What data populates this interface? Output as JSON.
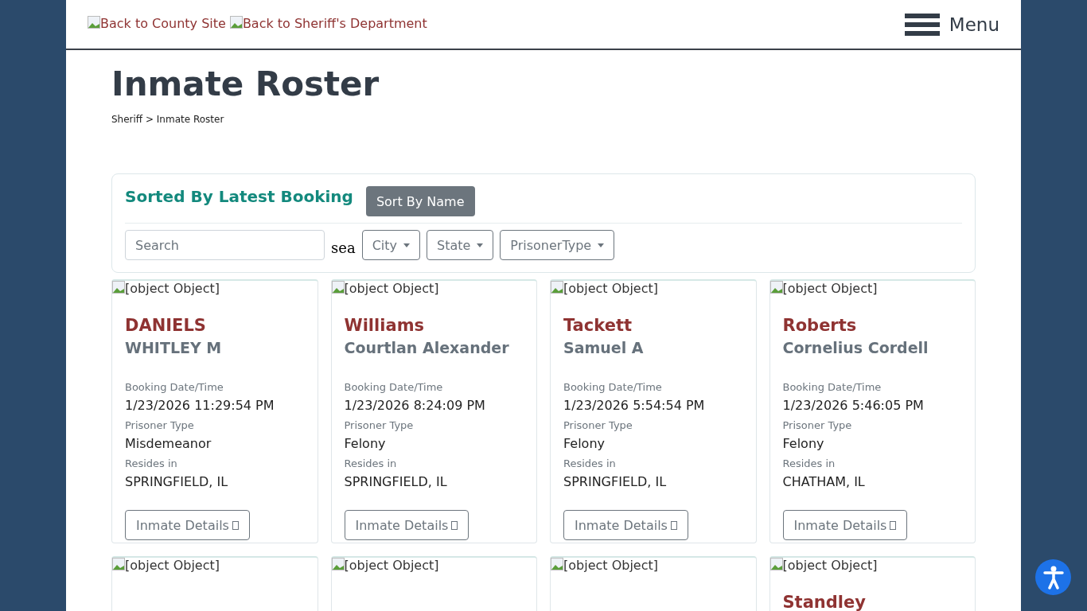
{
  "header": {
    "links": [
      "Back to County Site",
      "Back to Sheriff's Department"
    ],
    "menu_label": "Menu"
  },
  "page": {
    "title": "Inmate Roster",
    "breadcrumb": "Sheriff > Inmate Roster"
  },
  "toolbar": {
    "sort_heading": "Sorted By Latest Booking",
    "sort_button": "Sort By Name",
    "search": {
      "placeholder": "Search"
    },
    "search_label": "sea",
    "filters": [
      "City",
      "State",
      "PrisonerType"
    ]
  },
  "inmates": [
    {
      "image_alt": "[object Object]",
      "last_name": "DANIELS",
      "first_name": "WHITLEY M",
      "booking_label": "Booking Date/Time",
      "booking": "1/23/2026 11:29:54 PM",
      "type_label": "Prisoner Type",
      "type": "Misdemeanor",
      "resides_label": "Resides in",
      "resides": "SPRINGFIELD, IL",
      "button": "Inmate Details"
    },
    {
      "image_alt": "[object Object]",
      "last_name": "Williams",
      "first_name": "Courtlan Alexander",
      "booking_label": "Booking Date/Time",
      "booking": "1/23/2026 8:24:09 PM",
      "type_label": "Prisoner Type",
      "type": "Felony",
      "resides_label": "Resides in",
      "resides": "SPRINGFIELD, IL",
      "button": "Inmate Details"
    },
    {
      "image_alt": "[object Object]",
      "last_name": "Tackett",
      "first_name": "Samuel A",
      "booking_label": "Booking Date/Time",
      "booking": "1/23/2026 5:54:54 PM",
      "type_label": "Prisoner Type",
      "type": "Felony",
      "resides_label": "Resides in",
      "resides": "SPRINGFIELD, IL",
      "button": "Inmate Details"
    },
    {
      "image_alt": "[object Object]",
      "last_name": "Roberts",
      "first_name": "Cornelius Cordell",
      "booking_label": "Booking Date/Time",
      "booking": "1/23/2026 5:46:05 PM",
      "type_label": "Prisoner Type",
      "type": "Felony",
      "resides_label": "Resides in",
      "resides": "CHATHAM, IL",
      "button": "Inmate Details"
    },
    {
      "image_alt": "[object Object]"
    },
    {
      "image_alt": "[object Object]"
    },
    {
      "image_alt": "[object Object]"
    },
    {
      "image_alt": "[object Object]",
      "last_name": "Standley"
    }
  ]
}
